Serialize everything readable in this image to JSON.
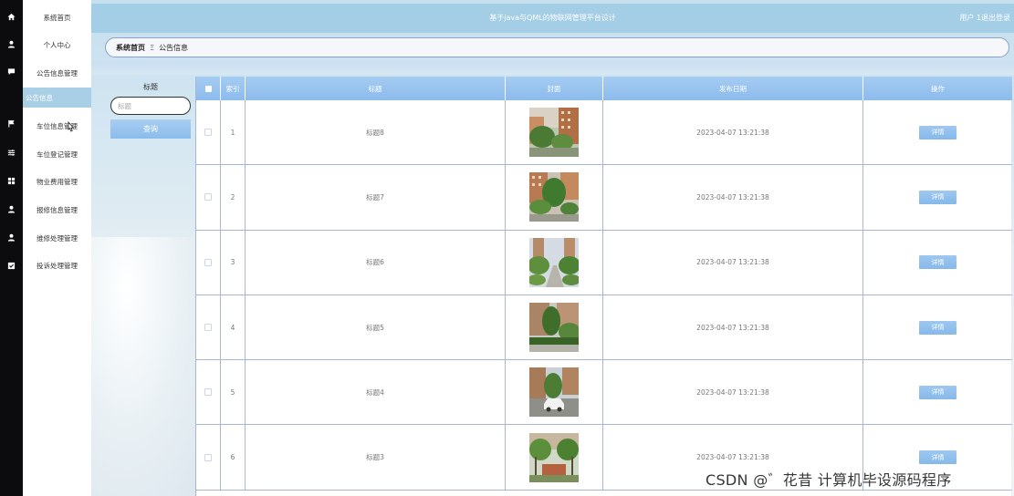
{
  "app": {
    "title": "基于java与QML的物联网管理平台设计",
    "user_label": "用户 1",
    "logout_label": "退出登录"
  },
  "sidebar": {
    "items": [
      {
        "label": "系统首页",
        "icon": "home-icon"
      },
      {
        "label": "个人中心",
        "icon": "user-icon"
      },
      {
        "label": "公告信息管理",
        "icon": "message-icon"
      },
      {
        "label": "车位信息管理",
        "icon": "flag-icon"
      },
      {
        "label": "车位登记管理",
        "icon": "sliders-icon"
      },
      {
        "label": "物业费用管理",
        "icon": "grid-icon"
      },
      {
        "label": "报修信息管理",
        "icon": "user-icon"
      },
      {
        "label": "维修处理管理",
        "icon": "user-icon"
      },
      {
        "label": "投诉处理管理",
        "icon": "checkbox-icon"
      }
    ],
    "sub_item": "公告信息"
  },
  "breadcrumb": {
    "home": "系统首页",
    "separator": "Ξ",
    "current": "公告信息"
  },
  "search": {
    "label": "标题",
    "placeholder": "标题",
    "button": "查询"
  },
  "table": {
    "columns": [
      "索引",
      "标题",
      "封面",
      "发布日期",
      "操作"
    ],
    "rows": [
      {
        "index": "1",
        "title": "标题8",
        "date": "2023-04-07 13:21:38",
        "action": "详情"
      },
      {
        "index": "2",
        "title": "标题7",
        "date": "2023-04-07 13:21:38",
        "action": "详情"
      },
      {
        "index": "3",
        "title": "标题6",
        "date": "2023-04-07 13:21:38",
        "action": "详情"
      },
      {
        "index": "4",
        "title": "标题5",
        "date": "2023-04-07 13:21:38",
        "action": "详情"
      },
      {
        "index": "5",
        "title": "标题4",
        "date": "2023-04-07 13:21:38",
        "action": "详情"
      },
      {
        "index": "6",
        "title": "标题3",
        "date": "2023-04-07 13:21:38",
        "action": "详情"
      }
    ]
  },
  "watermark": "CSDN @゛花昔 计算机毕设源码程序",
  "colors": {
    "accent": "#a4cde6",
    "header_blue": "#8cbbed",
    "rail": "#0c0c0e"
  }
}
